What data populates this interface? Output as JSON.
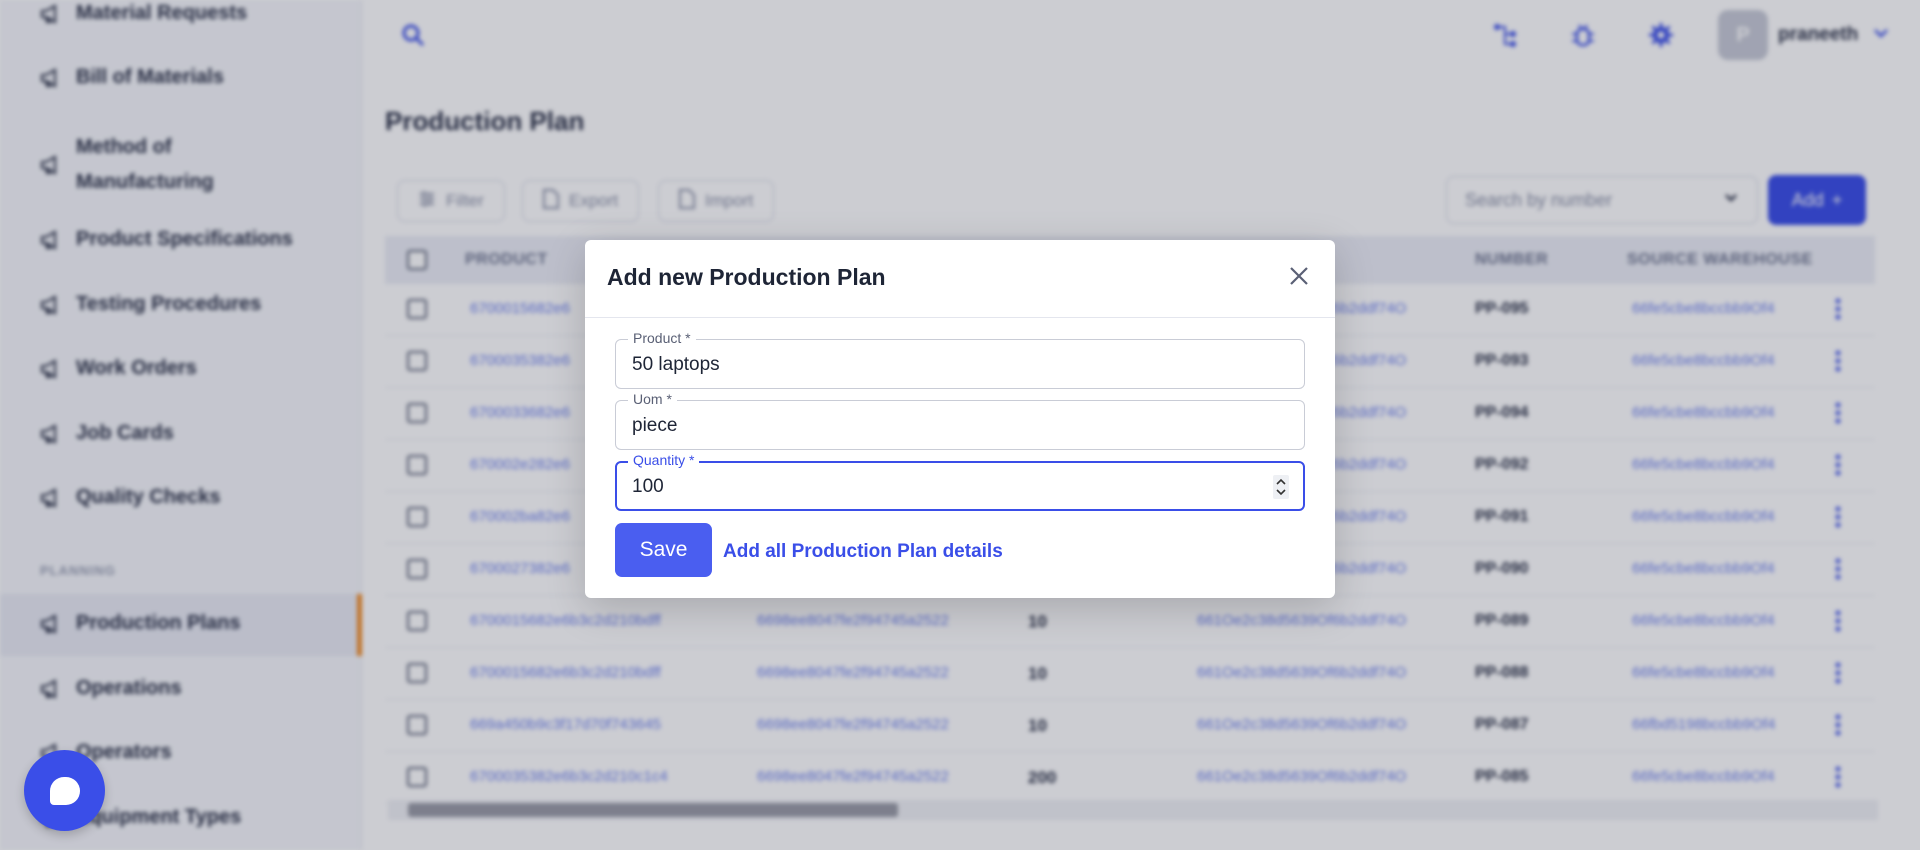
{
  "sidebar": {
    "items": [
      {
        "label": "Material Requests"
      },
      {
        "label": "Bill of Materials"
      },
      {
        "label": "Method of"
      },
      {
        "label": "Manufacturing"
      },
      {
        "label": "Product Specifications"
      },
      {
        "label": "Testing Procedures"
      },
      {
        "label": "Work Orders"
      },
      {
        "label": "Job Cards"
      },
      {
        "label": "Quality Checks"
      },
      {
        "label": "Production Plans"
      },
      {
        "label": "Operations"
      },
      {
        "label": "Operators"
      },
      {
        "label": "Equipment Types"
      }
    ],
    "section_planning": "PLANNING",
    "active_item": "Production Plans"
  },
  "topbar": {
    "avatar_initial": "P",
    "username": "praneeth"
  },
  "page": {
    "title": "Production Plan",
    "filter_label": "Filter",
    "export_label": "Export",
    "import_label": "Import",
    "search_placeholder": "Search by number",
    "add_label": "Add"
  },
  "table": {
    "headers": {
      "product": "PRODUCT",
      "number": "NUMBER",
      "source_warehouse": "SOURCE WAREHOUSE"
    },
    "rows": [
      {
        "product": "6700015682e6",
        "bom": "",
        "qty": "",
        "wo": "661Oe2c38d5639Of6b2ddf74O",
        "number": "PP-095",
        "warehouse": "66fe5cbe8bccbb9Of4"
      },
      {
        "product": "6700035382e6",
        "bom": "",
        "qty": "",
        "wo": "661Oe2c38d5639Of6b2ddf74O",
        "number": "PP-093",
        "warehouse": "66fe5cbe8bccbb9Of4"
      },
      {
        "product": "6700033682e6",
        "bom": "",
        "qty": "",
        "wo": "661Oe2c38d5639Of6b2ddf74O",
        "number": "PP-094",
        "warehouse": "66fe5cbe8bccbb9Of4"
      },
      {
        "product": "670002e282e6",
        "bom": "",
        "qty": "",
        "wo": "661Oe2c38d5639Of6b2ddf74O",
        "number": "PP-092",
        "warehouse": "66fe5cbe8bccbb9Of4"
      },
      {
        "product": "670002ba82e6",
        "bom": "",
        "qty": "",
        "wo": "661Oe2c38d5639Of6b2ddf74O",
        "number": "PP-091",
        "warehouse": "66fe5cbe8bccbb9Of4"
      },
      {
        "product": "6700027382e6",
        "bom": "",
        "qty": "",
        "wo": "661Oe2c38d5639Of6b2ddf74O",
        "number": "PP-090",
        "warehouse": "66fe5cbe8bccbb9Of4"
      },
      {
        "product": "6700015682e6b3c2d210bdff",
        "bom": "6698ee8047fe2f94745a2522",
        "qty": "10",
        "wo": "661Oe2c38d5639Of6b2ddf74O",
        "number": "PP-089",
        "warehouse": "66fe5cbe8bccbb9Of4"
      },
      {
        "product": "6700015682e6b3c2d210bdff",
        "bom": "6698ee8047fe2f94745a2522",
        "qty": "10",
        "wo": "661Oe2c38d5639Of6b2ddf74O",
        "number": "PP-088",
        "warehouse": "66fe5cbe8bccbb9Of4"
      },
      {
        "product": "669a450b9c3f17d70f743645",
        "bom": "6698ee8047fe2f94745a2522",
        "qty": "10",
        "wo": "661Oe2c38d5639Of6b2ddf74O",
        "number": "PP-087",
        "warehouse": "66fbd5198bccbb9Of4"
      },
      {
        "product": "6700035382e6b3c2d210c1c4",
        "bom": "6698ee8047fe2f94745a2522",
        "qty": "200",
        "wo": "661Oe2c38d5639Of6b2ddf74O",
        "number": "PP-085",
        "warehouse": "66fe5cbe8bccbb9Of4"
      }
    ]
  },
  "modal": {
    "title": "Add new Production Plan",
    "fields": {
      "product": {
        "label": "Product *",
        "value": "50 laptops"
      },
      "uom": {
        "label": "Uom *",
        "value": "piece"
      },
      "quantity": {
        "label": "Quantity *",
        "value": "100"
      }
    },
    "save_label": "Save",
    "details_link": "Add all Production Plan details"
  },
  "colors": {
    "primary": "#3a4ee8",
    "active_accent": "#f08a24"
  }
}
